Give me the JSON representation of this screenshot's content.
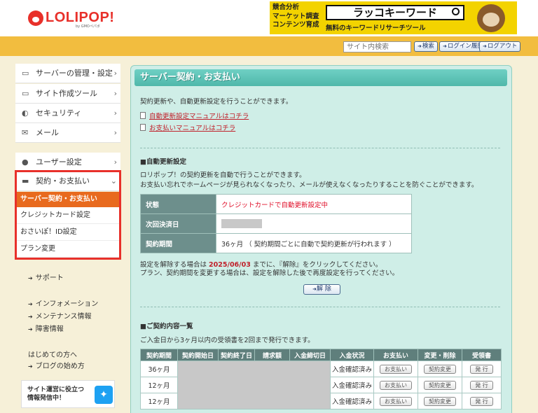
{
  "header": {
    "logo_text": "LOLIPOP!",
    "logo_sub": "by GMOペパボ",
    "ad": {
      "left_lines": [
        "競合分析",
        "マーケット調査",
        "コンテンツ育成"
      ],
      "title": "ラッコキーワード",
      "sub": "無料のキーワードリサーチツール"
    },
    "search_placeholder": "サイト内検索",
    "buttons": {
      "search": "検索",
      "history": "ログイン履歴",
      "logout": "ログアウト"
    }
  },
  "sidebar": {
    "items": [
      {
        "label": "サーバーの管理・設定",
        "icon": "server-icon"
      },
      {
        "label": "サイト作成ツール",
        "icon": "laptop-icon"
      },
      {
        "label": "セキュリティ",
        "icon": "shield-icon"
      },
      {
        "label": "メール",
        "icon": "mail-icon"
      },
      {
        "label": "ユーザー設定",
        "icon": "user-icon"
      },
      {
        "label": "契約・お支払い",
        "icon": "card-icon"
      }
    ],
    "sub_items": [
      "サーバー契約・お支払い",
      "クレジットカード設定",
      "おさいぽ！ID設定",
      "プラン変更"
    ],
    "links": [
      "サポート",
      "インフォメーション",
      "メンテナンス情報",
      "障害情報"
    ],
    "plain_links": [
      "はじめての方へ",
      "ブログの始め方"
    ],
    "banner": {
      "line1": "サイト運営に役立つ",
      "line2": "情報発信中！"
    }
  },
  "main": {
    "title": "サーバー契約・お支払い",
    "intro": "契約更新や、自動更新設定を行うことができます。",
    "manual_links": [
      "自動更新設定マニュアルはコチラ",
      "お支払いマニュアルはコチラ"
    ],
    "auto": {
      "heading": "■自動更新設定",
      "desc1": "ロリポップ！の契約更新を自動で行うことができます。",
      "desc2": "お支払い忘れでホームページが見られなくなったり、メールが使えなくなったりすることを防ぐことができます。",
      "rows": [
        {
          "label": "状態",
          "value": "クレジットカードで自動更新設定中"
        },
        {
          "label": "次回決済日",
          "value": ""
        },
        {
          "label": "契約期間",
          "value": "36ヶ月 （ 契約期間ごとに自動で契約更新が行われます ）"
        }
      ],
      "note1_pre": "設定を解除する場合は ",
      "note1_date": "2025/06/03",
      "note1_post": " までに、『解除』をクリックしてください。",
      "note2": "プラン、契約期間を変更する場合は、設定を解除した後で再度設定を行ってください。",
      "cancel_button": "解 除"
    },
    "contracts": {
      "heading": "■ご契約内容一覧",
      "desc": "ご入金日から3ヶ月以内の受領書を2回まで発行できます。",
      "columns": [
        "契約期間",
        "契約開始日",
        "契約終了日",
        "請求額",
        "入金締切日",
        "入金状況",
        "お支払い",
        "変更・削除",
        "受領書"
      ],
      "rows": [
        {
          "period": "36ヶ月",
          "status": "入金確認済み",
          "pay": "お支払い",
          "change": "契約変更",
          "receipt": "発 行"
        },
        {
          "period": "12ヶ月",
          "status": "入金確認済み",
          "pay": "お支払い",
          "change": "契約変更",
          "receipt": "発 行"
        },
        {
          "period": "12ヶ月",
          "status": "入金確認済み",
          "pay": "お支払い",
          "change": "契約変更",
          "receipt": "発 行"
        }
      ]
    }
  }
}
